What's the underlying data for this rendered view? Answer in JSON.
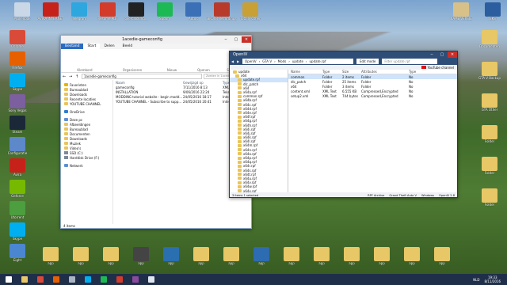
{
  "desktop": {
    "icons_top": [
      {
        "label": "Prullenbak",
        "color": "#c9d7e6"
      },
      {
        "label": "AVIRA INTERNET",
        "color": "#c7221a"
      },
      {
        "label": "Telegram",
        "color": "#2ea6de"
      },
      {
        "label": "Resume.PDF",
        "color": "#d33b2a"
      },
      {
        "label": "overclocking...",
        "color": "#222222"
      },
      {
        "label": "Spotify",
        "color": "#1db954"
      },
      {
        "label": "Autoit",
        "color": "#3b6fb6"
      },
      {
        "label": "BKOVR Recordings",
        "color": "#b83a2a"
      },
      {
        "label": "Totally Other",
        "color": "#c9a034"
      }
    ],
    "icons_top_right": [
      {
        "label": "NAME VERSIE",
        "color": "#d8c189"
      },
      {
        "label": "TEKST",
        "color": "#2c5d9f"
      }
    ],
    "icons_left": [
      {
        "label": "Chrome",
        "color": "#d94a38"
      },
      {
        "label": "Firefox",
        "color": "#e66000"
      },
      {
        "label": "Skype",
        "color": "#00aff0"
      },
      {
        "label": "Sony Vegas",
        "color": "#7c5f9e"
      },
      {
        "label": "Steam",
        "color": "#1b2838"
      },
      {
        "label": "Configuratie",
        "color": "#5d88c9"
      },
      {
        "label": "Avira",
        "color": "#c7221a"
      },
      {
        "label": "Geforce",
        "color": "#76b900"
      },
      {
        "label": "Utorrent",
        "color": "#4c9e3e"
      },
      {
        "label": "Skype",
        "color": "#00aff0"
      },
      {
        "label": "Eight",
        "color": "#4b86d1"
      }
    ],
    "icons_right": [
      {
        "label": "Documenten",
        "color": "#e7c766"
      },
      {
        "label": "GTA V Backup",
        "color": "#e7c766"
      },
      {
        "label": "GTA Other",
        "color": "#e7c766"
      },
      {
        "label": "Folder",
        "color": "#e7c766"
      },
      {
        "label": "Folder",
        "color": "#e7c766"
      },
      {
        "label": "Folder",
        "color": "#e7c766"
      }
    ],
    "icons_bottom": [
      {
        "label": "app",
        "color": "#e7c766"
      },
      {
        "label": "app",
        "color": "#e7c766"
      },
      {
        "label": "app",
        "color": "#e7c766"
      },
      {
        "label": "app",
        "color": "#444444"
      },
      {
        "label": "app",
        "color": "#2a6fb0"
      },
      {
        "label": "app",
        "color": "#e7c766"
      },
      {
        "label": "app",
        "color": "#e7c766"
      },
      {
        "label": "app",
        "color": "#2d6cb0"
      },
      {
        "label": "app",
        "color": "#e7c766"
      },
      {
        "label": "app",
        "color": "#e7c766"
      },
      {
        "label": "app",
        "color": "#e7c766"
      },
      {
        "label": "app",
        "color": "#e7c766"
      },
      {
        "label": "app",
        "color": "#e7c766"
      },
      {
        "label": "app",
        "color": "#e7c766"
      }
    ]
  },
  "explorer": {
    "title": "1acedie-gameconfig",
    "tabs": [
      "Bestand",
      "Start",
      "Delen",
      "Beeld"
    ],
    "ribbon_groups": [
      "Klembord",
      "Organiseren",
      "Nieuw",
      "Openen",
      "Selecteren"
    ],
    "address": "1acedie-gameconfig",
    "search_placeholder": "Zoeken in 1acedie-gameconfig",
    "columns": [
      "Naam",
      "Gewijzigd op",
      "Type"
    ],
    "files": [
      {
        "name": "gameconfig",
        "date": "7/11/2016 8:13",
        "type": "XML-docum"
      },
      {
        "name": "INSTALLATION",
        "date": "9/06/2016 22:24",
        "type": "Tekstdocu"
      },
      {
        "name": "MODDING tutorial website - begin modd...",
        "date": "24/05/2016 18:17",
        "type": "Internetsn"
      },
      {
        "name": "YOUTUBE CHANNEL - Subscribe to supp...",
        "date": "24/05/2016 20:41",
        "type": "Internetsn"
      }
    ],
    "nav": [
      {
        "label": "Favorieten",
        "kind": "star"
      },
      {
        "label": "Bureaublad",
        "kind": "fold"
      },
      {
        "label": "Downloads",
        "kind": "fold"
      },
      {
        "label": "Recente locaties",
        "kind": "fold"
      },
      {
        "label": "YOUTUBE CHANNEL",
        "kind": "fold"
      },
      {
        "label": "OneDrive",
        "kind": "cloud"
      },
      {
        "label": "Deze pc",
        "kind": "pc"
      },
      {
        "label": "Afbeeldingen",
        "kind": "fold"
      },
      {
        "label": "Bureaublad",
        "kind": "fold"
      },
      {
        "label": "Documenten",
        "kind": "fold"
      },
      {
        "label": "Downloads",
        "kind": "fold"
      },
      {
        "label": "Muziek",
        "kind": "fold"
      },
      {
        "label": "Video's",
        "kind": "fold"
      },
      {
        "label": "SSD (C:)",
        "kind": "drive"
      },
      {
        "label": "Harddisk Drive (F:)",
        "kind": "drive"
      },
      {
        "label": "Netwerk",
        "kind": "net"
      }
    ],
    "status": "4 items"
  },
  "openiv": {
    "title": "OpenIV",
    "breadcrumb": [
      "OpenIV",
      "GTA V",
      "Mods",
      "update",
      "update.rpf"
    ],
    "edit_mode_label": "Edit mode",
    "search_placeholder": "Filter update.rpf",
    "youtube_label": "YouTube channel",
    "tree": [
      "update",
      "x64",
      "update.rpf",
      "dlc_patch",
      "x64",
      "x64a.rpf",
      "common.rpf",
      "x64b.rpf",
      "x64c.rpf",
      "x64d.rpf",
      "x64e.rpf",
      "x64f.rpf",
      "x64g.rpf",
      "x64h.rpf",
      "x64i.rpf",
      "x64j.rpf",
      "x64k.rpf",
      "x64l.rpf",
      "x64m.rpf",
      "x64n.rpf",
      "x64o.rpf",
      "x64p.rpf",
      "x64q.rpf",
      "x64r.rpf",
      "x64s.rpf",
      "x64t.rpf",
      "x64u.rpf",
      "x64v.rpf",
      "x64w.rpf",
      "x64x.rpf"
    ],
    "columns": [
      "Name",
      "Type",
      "Size",
      "Attributes",
      "Type"
    ],
    "files": [
      {
        "name": "common",
        "type": "Folder",
        "size": "2 items",
        "attr": "Folder",
        "kind": "No"
      },
      {
        "name": "dlc_patch",
        "type": "Folder",
        "size": "25 items",
        "attr": "Folder",
        "kind": "No"
      },
      {
        "name": "x64",
        "type": "Folder",
        "size": "3 items",
        "attr": "Folder",
        "kind": "No"
      },
      {
        "name": "content.xml",
        "type": "XML Text",
        "size": "6,555 KB",
        "attr": "Compressed,Encrypted",
        "kind": "No"
      },
      {
        "name": "setup2.xml",
        "type": "XML Text",
        "size": "744 bytes",
        "attr": "Compressed,Encrypted",
        "kind": "No"
      }
    ],
    "status_left": "3 items 1 selected",
    "status_right": [
      "RPF Archive",
      "Grand Theft Auto V",
      "Windows",
      "OpenIV 2.8"
    ]
  },
  "taskbar": {
    "buttons": [
      {
        "name": "start",
        "color": "#ffffff"
      },
      {
        "name": "explorer",
        "color": "#e7c766"
      },
      {
        "name": "chrome",
        "color": "#d94a38"
      },
      {
        "name": "firefox",
        "color": "#e66000"
      },
      {
        "name": "steam",
        "color": "#aab4c2"
      },
      {
        "name": "skype",
        "color": "#00aff0"
      },
      {
        "name": "spotify",
        "color": "#1db954"
      },
      {
        "name": "openiv",
        "color": "#d23c2a"
      },
      {
        "name": "winrar",
        "color": "#8b4a9e"
      },
      {
        "name": "notepad",
        "color": "#dfe6ef"
      }
    ],
    "time": "19:33",
    "date": "8/11/2016",
    "lang": "NLD"
  }
}
